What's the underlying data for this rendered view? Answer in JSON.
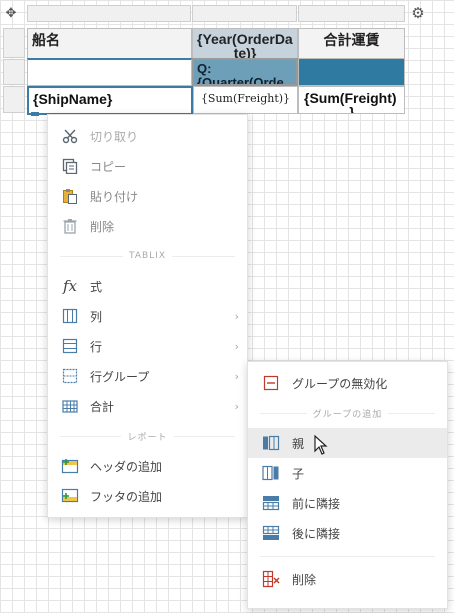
{
  "table": {
    "header": {
      "ship_name": "船名",
      "year": "{Year(OrderDa",
      "year_cont": "te)}",
      "total": "合計運賃"
    },
    "group_row": {
      "quarter": "Q:",
      "quarter2": "{Quarter(Orde"
    },
    "detail": {
      "ship_name": "{ShipName}",
      "sum_freight": "{Sum(Freight)}",
      "sum_freight_total": "{Sum(Freight)",
      "sum_freight_total_cont": "}"
    }
  },
  "context_menu": {
    "items": [
      {
        "label": "切り取り",
        "icon": "scissors-icon",
        "enabled": false
      },
      {
        "label": "コピー",
        "icon": "copy-icon",
        "enabled": false
      },
      {
        "label": "貼り付け",
        "icon": "paste-icon",
        "enabled": false
      },
      {
        "label": "削除",
        "icon": "trash-icon",
        "enabled": false
      }
    ],
    "section_tablix": "TABLIX",
    "tablix_items": [
      {
        "label": "式",
        "icon": "function-icon",
        "submenu": false
      },
      {
        "label": "列",
        "icon": "column-icon",
        "submenu": true
      },
      {
        "label": "行",
        "icon": "row-icon",
        "submenu": true
      },
      {
        "label": "行グループ",
        "icon": "row-group-icon",
        "submenu": true
      },
      {
        "label": "合計",
        "icon": "total-icon",
        "submenu": true
      }
    ],
    "section_report": "レポート",
    "report_items": [
      {
        "label": "ヘッダの追加",
        "icon": "add-header-icon"
      },
      {
        "label": "フッタの追加",
        "icon": "add-footer-icon"
      }
    ]
  },
  "submenu": {
    "disable_group": "グループの無効化",
    "section_add_group": "グループの追加",
    "items": [
      {
        "label": "親",
        "icon": "parent-group-icon",
        "highlighted": true
      },
      {
        "label": "子",
        "icon": "child-group-icon",
        "highlighted": false
      },
      {
        "label": "前に隣接",
        "icon": "adjacent-before-icon",
        "highlighted": false
      },
      {
        "label": "後に隣接",
        "icon": "adjacent-after-icon",
        "highlighted": false
      }
    ],
    "delete": "削除"
  },
  "colors": {
    "selection_blue": "#2f7aa0",
    "quarter_blue": "#6e9fb8",
    "accent": "#3a7ca5",
    "disabled_icon": "#9aa5ad",
    "delete_red": "#c0392b"
  }
}
